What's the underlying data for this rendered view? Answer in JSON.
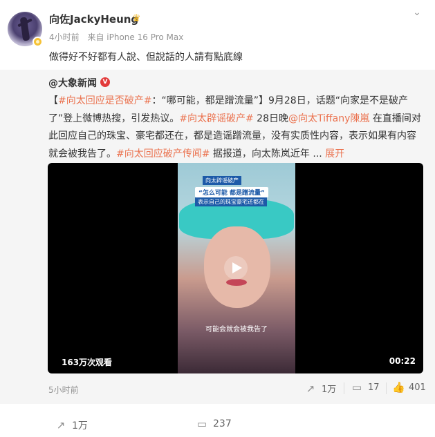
{
  "post": {
    "username": "向佐JackyHeung",
    "time": "4小时前",
    "source": "来自 iPhone 16 Pro Max",
    "text": "做得好不好都有人說、但說話的人請有點底線"
  },
  "repost": {
    "source_account": "@大象新闻",
    "segments": [
      "【",
      "#向太回应是否破产#",
      "：“哪可能，都是蹭流量”】9月28日，话题“向家是不是破产了”登上微博热搜，引发热议。",
      "#向太辟谣破产#",
      " 28日晚",
      "@向太Tiffany陳嵐",
      " 在直播间对此回应自己的珠宝、豪宅都还在，都是造谣蹭流量，没有实质性内容，表示如果有内容就会被我告了。",
      "#向太回应破产传闻#",
      " 据报道，向太陈岚近年 ... ",
      "展开"
    ],
    "video": {
      "caption_top": "向太辟谣破产",
      "caption_main": "“怎么可能 都是蹭流量”",
      "caption_sub": "表示自己的珠宝豪宅还都在",
      "subtitle": "可能会就会被我告了",
      "views": "163万次观看",
      "duration": "00:22"
    },
    "time": "5小时前",
    "reposts": "1万",
    "comments": "17",
    "likes": "401"
  },
  "footer": {
    "reposts": "1万",
    "comments": "237"
  },
  "colors": {
    "accent": "#eb7350",
    "verified_red": "#e23a3a",
    "verified_gold": "#f6c236"
  },
  "icons": [
    "more-icon",
    "crown-icon",
    "play-icon",
    "share-icon",
    "comment-icon",
    "like-icon"
  ]
}
